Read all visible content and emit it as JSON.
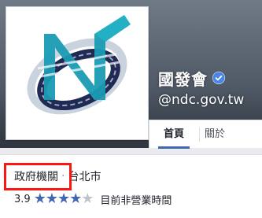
{
  "page": {
    "name": "國發會",
    "handle": "@ndc.gov.tw"
  },
  "tabs": [
    {
      "label": "首頁"
    },
    {
      "label": "關於"
    }
  ],
  "info": {
    "category": "政府機關",
    "separator": "·",
    "location": "台北市",
    "rating": "3.9",
    "stars_total": 5,
    "stars_filled": 4,
    "hours_status": "目前非營業時間"
  },
  "colors": {
    "accent": "#4267b2",
    "highlight": "#ff1414"
  }
}
